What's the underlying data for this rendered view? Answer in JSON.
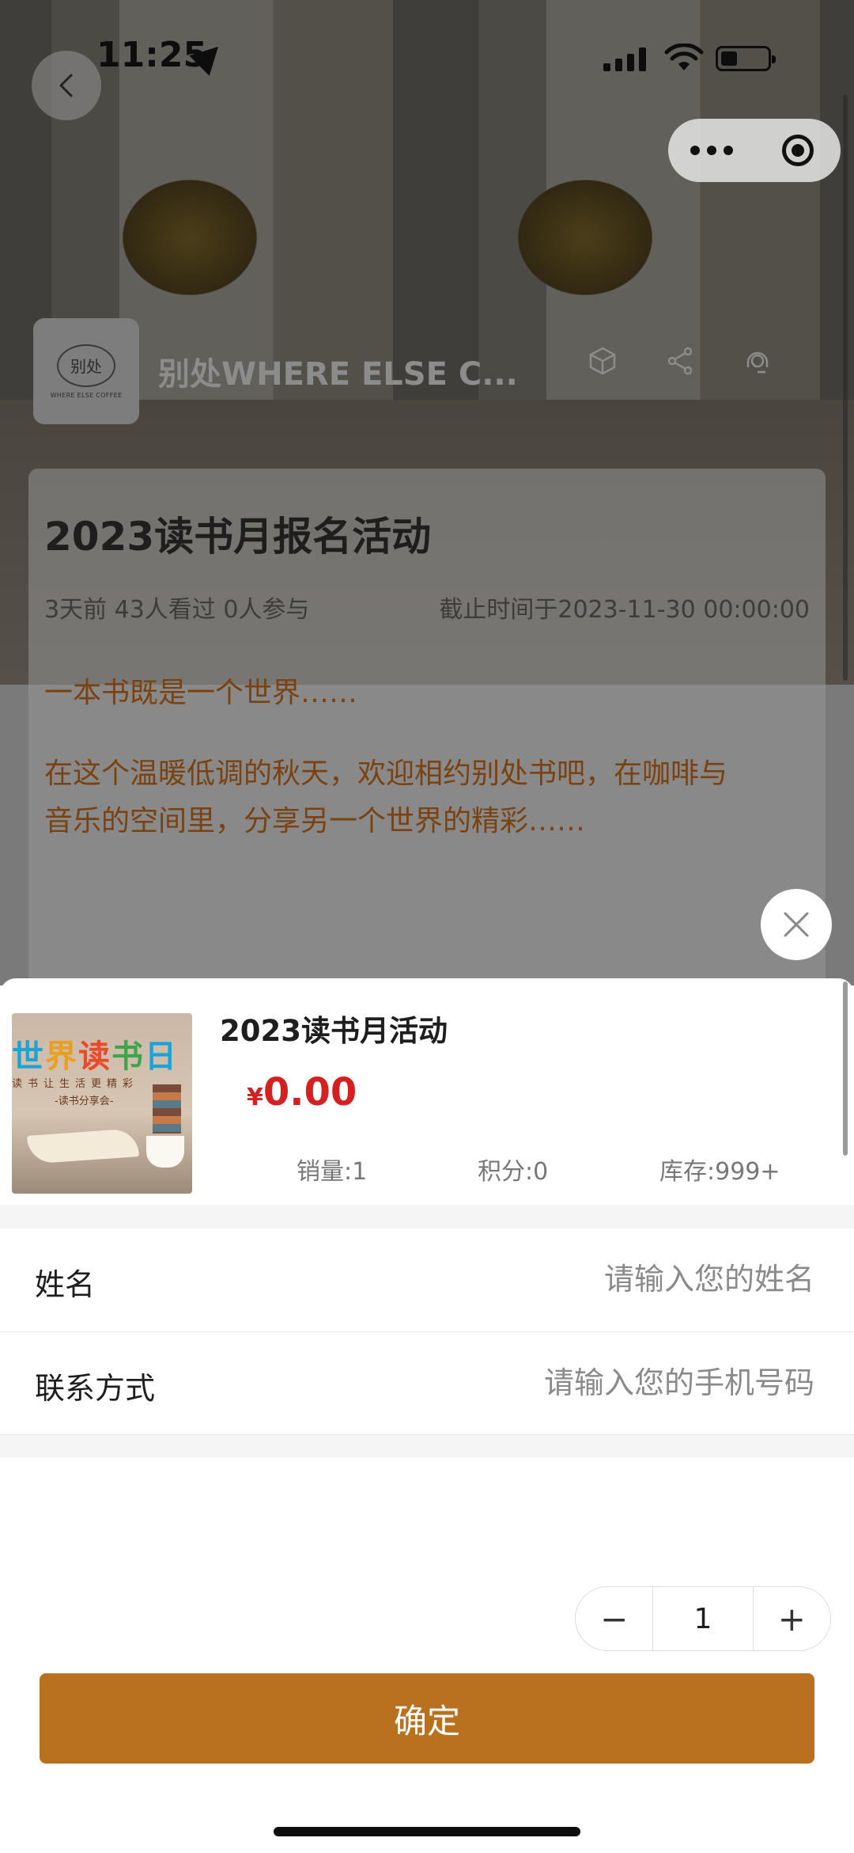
{
  "status_bar": {
    "time": "11:25"
  },
  "store": {
    "name": "别处WHERE ELSE C...",
    "logo_text": "别处",
    "logo_subtext": "WHERE ELSE COFFEE"
  },
  "activity": {
    "title": "2023读书月报名活动",
    "meta": "3天前 43人看过 0人参与",
    "deadline": "截止时间于2023-11-30 00:00:00",
    "paragraph1": "一本书既是一个世界……",
    "paragraph2_line1": "在这个温暖低调的秋天，欢迎相约别处书吧，在咖啡与",
    "paragraph2_line2": "音乐的空间里，分享另一个世界的精彩……"
  },
  "product": {
    "image_title": [
      "世",
      "界",
      "读",
      "书",
      "日"
    ],
    "image_line2": "读书让生活更精彩",
    "image_line3": "-读书分享会-",
    "title": "2023读书月活动",
    "currency": "¥",
    "price": "0.00",
    "sales": "销量:1",
    "points": "积分:0",
    "stock": "库存:999+"
  },
  "form": {
    "name_label": "姓名",
    "name_placeholder": "请输入您的姓名",
    "contact_label": "联系方式",
    "contact_placeholder": "请输入您的手机号码"
  },
  "quantity": {
    "minus": "−",
    "value": "1",
    "plus": "+"
  },
  "confirm_label": "确定",
  "colors": {
    "accent": "#b9711f",
    "price": "#d42020",
    "body_text": "#7a4210"
  }
}
